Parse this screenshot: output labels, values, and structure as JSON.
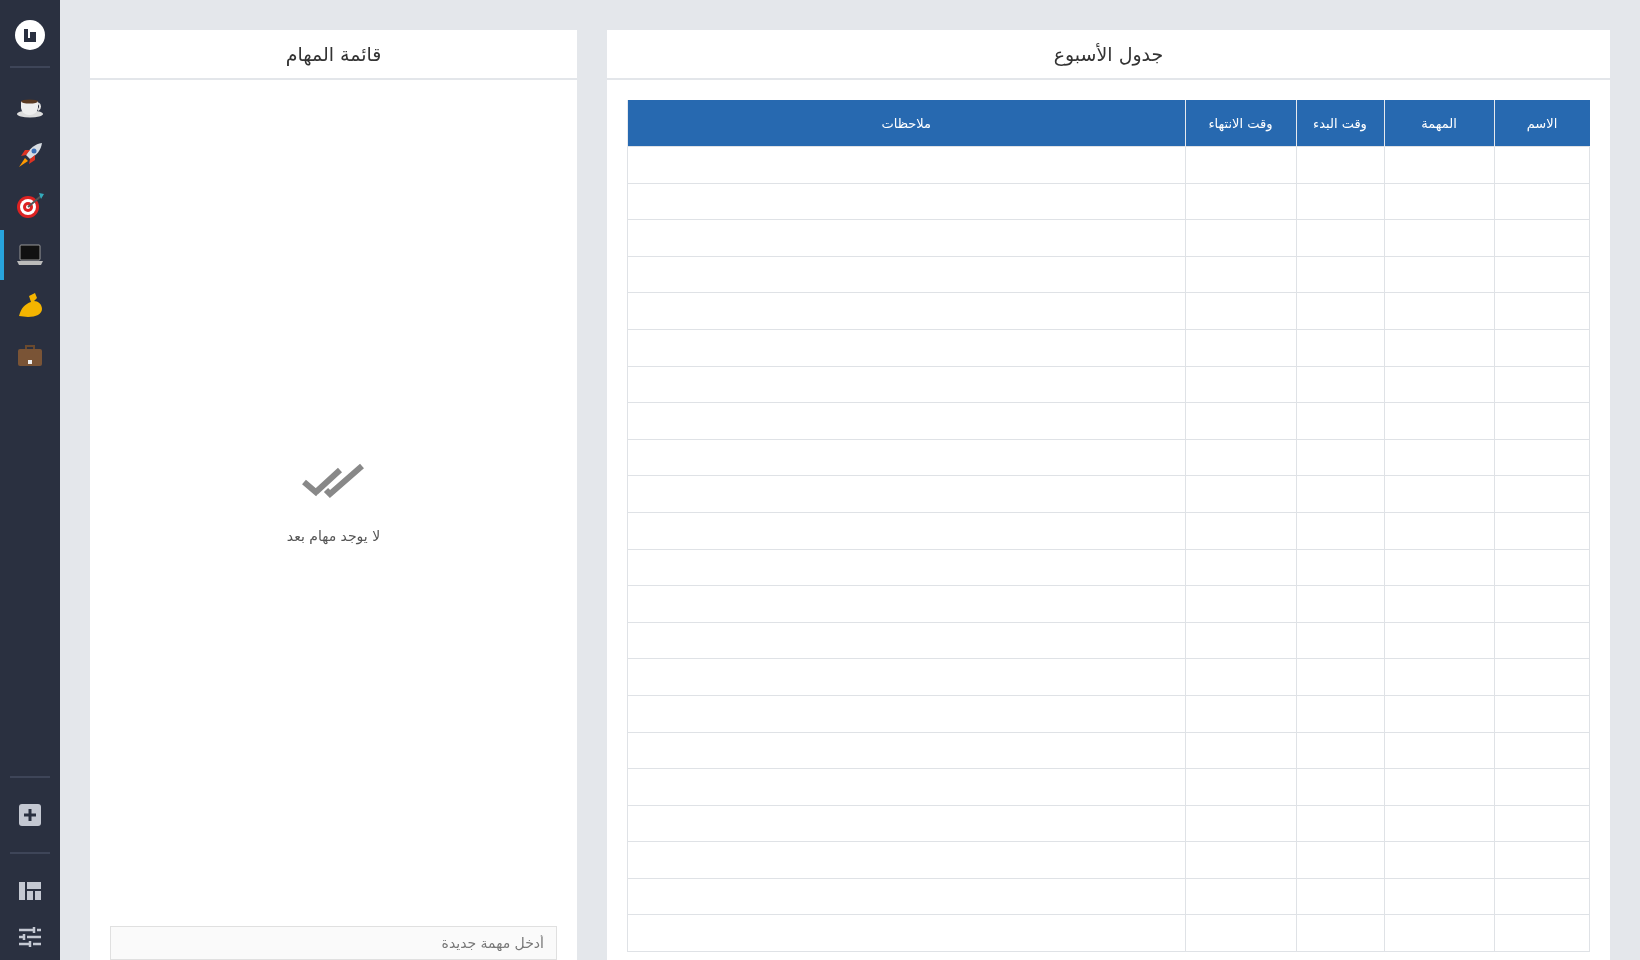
{
  "sidebar": {
    "top_items": [
      {
        "kind": "cup",
        "selected": false
      },
      {
        "kind": "rocket",
        "selected": false
      },
      {
        "kind": "target",
        "selected": false
      },
      {
        "kind": "laptop",
        "selected": true
      },
      {
        "kind": "arm",
        "selected": false
      },
      {
        "kind": "briefcase",
        "selected": false
      }
    ],
    "bottom_items": [
      {
        "kind": "layout"
      },
      {
        "kind": "sliders"
      }
    ]
  },
  "schedule": {
    "title": "جدول الأسبوع",
    "table": {
      "columns": [
        "الاسم",
        "المهمة",
        "وقت البدء",
        "وقت الانتهاء",
        "ملاحظات"
      ],
      "rows": [
        {},
        {},
        {},
        {},
        {},
        {},
        {},
        {},
        {},
        {},
        {},
        {},
        {},
        {},
        {},
        {},
        {},
        {},
        {},
        {},
        {},
        {}
      ]
    }
  },
  "tasks": {
    "title": "قائمة المهام",
    "empty_message": "لا يوجد مهام بعد",
    "new_task": {
      "placeholder": "أدخل مهمة جديدة"
    }
  }
}
